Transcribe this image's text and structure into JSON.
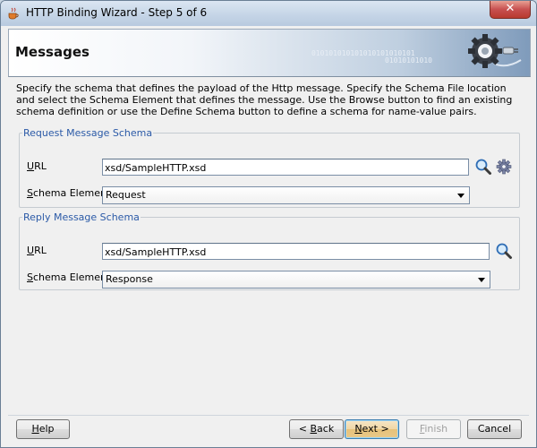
{
  "window": {
    "title": "HTTP Binding Wizard - Step 5 of 6",
    "close_label": "✕"
  },
  "header": {
    "title": "Messages",
    "binary_1": "010101010101010101010101",
    "binary_2": "01010101010"
  },
  "description": "Specify the schema that defines the payload of the Http message.  Specify the Schema File location and select the Schema Element that defines the message. Use the Browse button to find an existing schema definition or use the Define Schema button to define a schema for name-value pairs.",
  "request": {
    "legend": "Request Message Schema",
    "url_label_u": "U",
    "url_label_rest": "RL",
    "url_value": "xsd/SampleHTTP.xsd",
    "element_label_u": "S",
    "element_label_rest": "chema Element",
    "element_value": "Request"
  },
  "reply": {
    "legend": "Reply Message Schema",
    "url_label_u": "U",
    "url_label_rest": "RL",
    "url_value": "xsd/SampleHTTP.xsd",
    "element_label_u": "S",
    "element_label_rest": "chema Element",
    "element_value": "Response"
  },
  "buttons": {
    "help_u": "H",
    "help_rest": "elp",
    "back_pre": "< ",
    "back_u": "B",
    "back_rest": "ack",
    "next_u": "N",
    "next_rest": "ext >",
    "finish_u": "F",
    "finish_rest": "inish",
    "cancel": "Cancel"
  },
  "icons": {
    "app": "java-cup-icon",
    "search": "magnifier-icon",
    "define": "gear-icon",
    "logo": "gear-plug-icon"
  },
  "colors": {
    "legend": "#2b5aa7",
    "default_button": "#3c7fb1",
    "close_button": "#c75050"
  }
}
